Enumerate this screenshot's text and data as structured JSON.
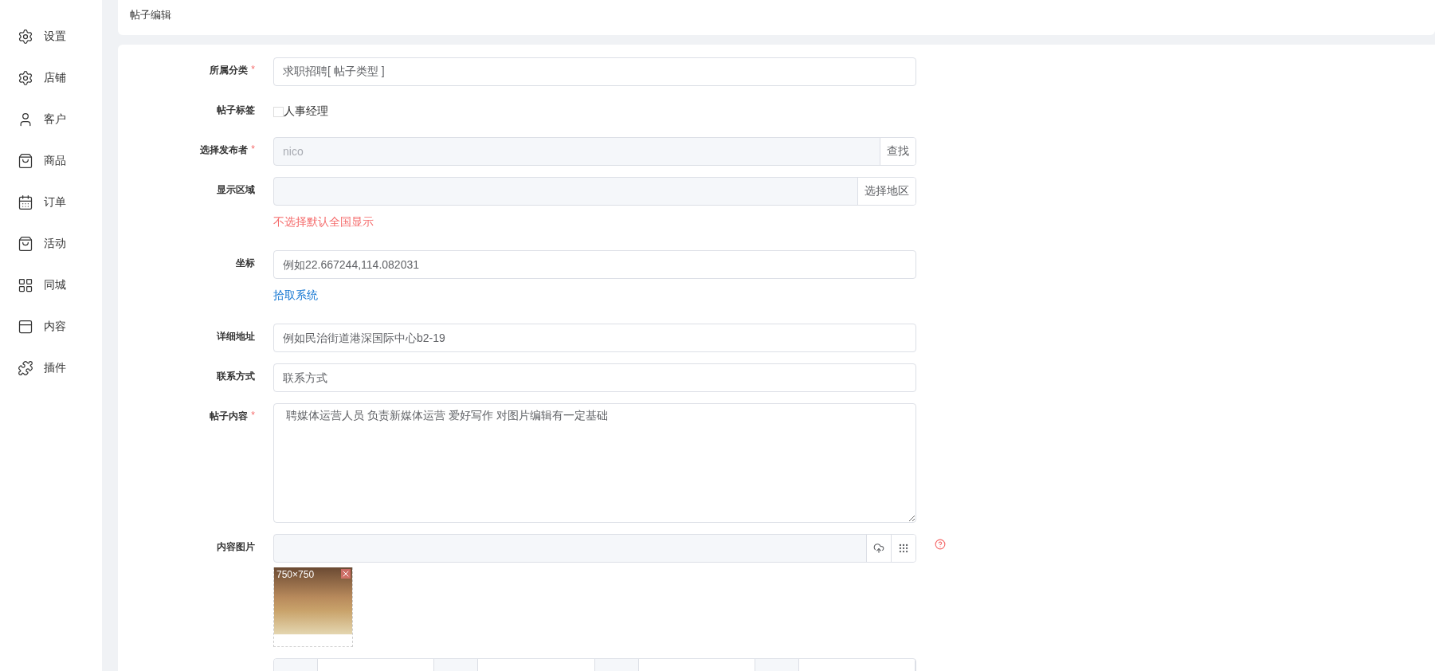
{
  "sidebar": {
    "items": [
      {
        "label": "设置"
      },
      {
        "label": "店铺"
      },
      {
        "label": "客户"
      },
      {
        "label": "商品"
      },
      {
        "label": "订单"
      },
      {
        "label": "活动"
      },
      {
        "label": "同城"
      },
      {
        "label": "内容"
      },
      {
        "label": "插件"
      }
    ]
  },
  "header": {
    "title": "帖子编辑"
  },
  "form": {
    "fields": [
      {
        "kind": "input",
        "label": "所属分类",
        "required_mark": "*",
        "value": "求职招聘[ 帖子类型 ]"
      },
      {
        "kind": "checkbox",
        "label": "帖子标签",
        "options": [
          {
            "label": "人事经理",
            "checked": false
          }
        ]
      },
      {
        "kind": "addon",
        "label": "选择发布者",
        "required_mark": "*",
        "placeholder": "nico",
        "button": "查找"
      },
      {
        "kind": "addon",
        "label": "显示区域",
        "button": "选择地区",
        "hint": "不选择默认全国显示"
      },
      {
        "kind": "input",
        "label": "坐标",
        "placeholder": "例如22.667244,114.082031",
        "link": "拾取系统"
      },
      {
        "kind": "input",
        "label": "详细地址",
        "placeholder": "例如民治街道港深国际中心b2-19"
      },
      {
        "kind": "input",
        "label": "联系方式",
        "placeholder": "联系方式"
      },
      {
        "kind": "textarea",
        "label": "帖子内容",
        "required_mark": "*",
        "value": " 聘媒体运营人员 负责新媒体运营 爱好写作 对图片编辑有一定基础"
      },
      {
        "kind": "upload",
        "label": "内容图片",
        "images": [
          {
            "size": "750×750"
          }
        ]
      },
      {
        "kind": "cutoff"
      }
    ]
  }
}
